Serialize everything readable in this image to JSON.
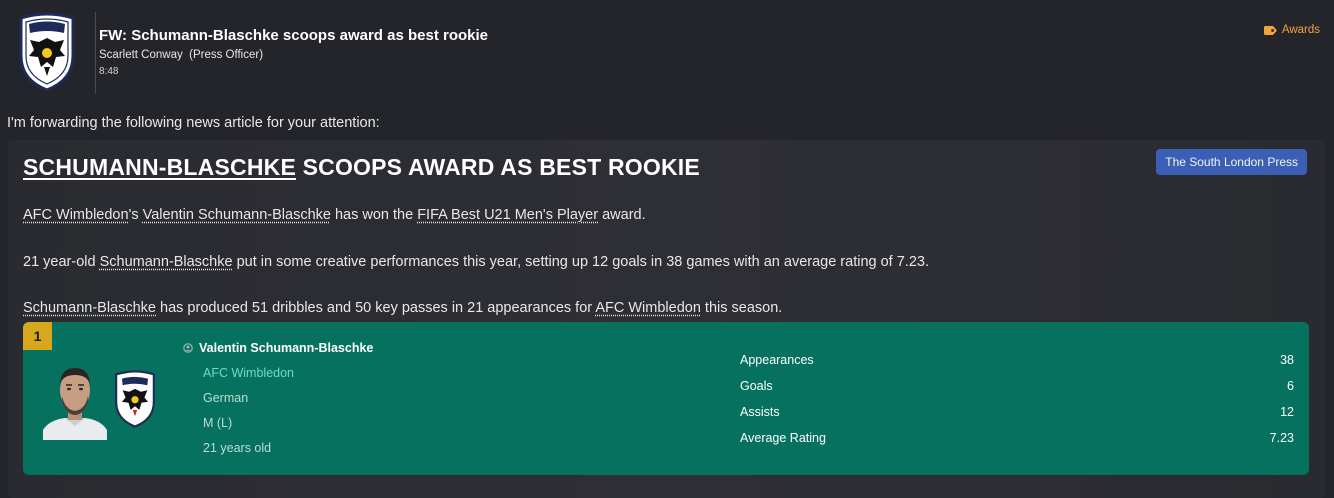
{
  "message": {
    "subject": "FW: Schumann-Blaschke scoops award as best rookie",
    "sender_name": "Scarlett Conway",
    "sender_role": "(Press Officer)",
    "time": "8:48",
    "category_label": "Awards",
    "intro": "I'm forwarding the following news article for your attention:"
  },
  "article": {
    "headline_player": "SCHUMANN-BLASCHKE",
    "headline_rest": " SCOOPS AWARD AS BEST ROOKIE",
    "source": "The South London Press",
    "p1": {
      "club": "AFC Wimbledon",
      "s1": "'s ",
      "player": "Valentin Schumann-Blaschke",
      "s2": " has won the ",
      "award": "FIFA Best U21 Men's Player",
      "s3": " award."
    },
    "p2": {
      "s1": "21 year-old ",
      "player": "Schumann-Blaschke",
      "s2": " put in some creative performances this year, setting up 12 goals in 38 games with an average rating of 7.23."
    },
    "p3": {
      "player": "Schumann-Blaschke",
      "s1": " has produced 51 dribbles and 50 key passes in 21 appearances for ",
      "club": "AFC Wimbledon",
      "s2": " this season."
    }
  },
  "player_card": {
    "rank": "1",
    "name": "Valentin Schumann-Blaschke",
    "club": "AFC Wimbledon",
    "nationality": "German",
    "position": "M (L)",
    "age": "21 years old",
    "stats": [
      {
        "label": "Appearances",
        "value": "38"
      },
      {
        "label": "Goals",
        "value": "6"
      },
      {
        "label": "Assists",
        "value": "12"
      },
      {
        "label": "Average Rating",
        "value": "7.23"
      }
    ]
  },
  "crest_text": "AFC WIMBLEDON",
  "colors": {
    "background": "#24252a",
    "card": "#07715f",
    "accent_orange": "#f0a43a",
    "source_button": "#3a5fb5",
    "rank_badge": "#d7a81b",
    "club_link": "#6fd7cf"
  },
  "icons": [
    "club-crest-icon",
    "tag-icon",
    "player-face",
    "person-icon"
  ]
}
